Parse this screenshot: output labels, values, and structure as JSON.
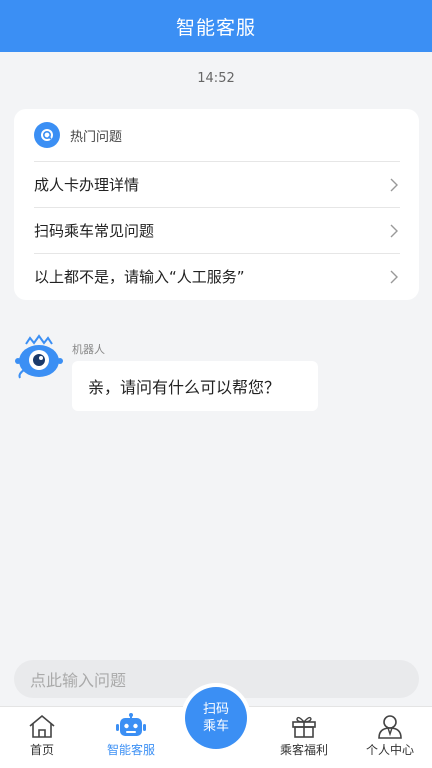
{
  "header": {
    "title": "智能客服"
  },
  "chat": {
    "timestamp": "14:52",
    "faq": {
      "title": "热门问题",
      "items": [
        {
          "label": "成人卡办理详情"
        },
        {
          "label": "扫码乘车常见问题"
        },
        {
          "label": "以上都不是，请输入“人工服务”"
        }
      ]
    },
    "message": {
      "sender": "机器人",
      "text": "亲，请问有什么可以帮您？"
    }
  },
  "input": {
    "placeholder": "点此输入问题"
  },
  "tabbar": {
    "items": [
      {
        "label": "首页",
        "icon": "home-icon"
      },
      {
        "label": "智能客服",
        "icon": "robot-icon",
        "active": true
      },
      {
        "label": "乘客福利",
        "icon": "gift-icon"
      },
      {
        "label": "个人中心",
        "icon": "user-icon"
      }
    ],
    "scan": {
      "line1": "扫码",
      "line2": "乘车"
    }
  },
  "colors": {
    "accent": "#3b8ff4",
    "background": "#f3f4f6"
  }
}
